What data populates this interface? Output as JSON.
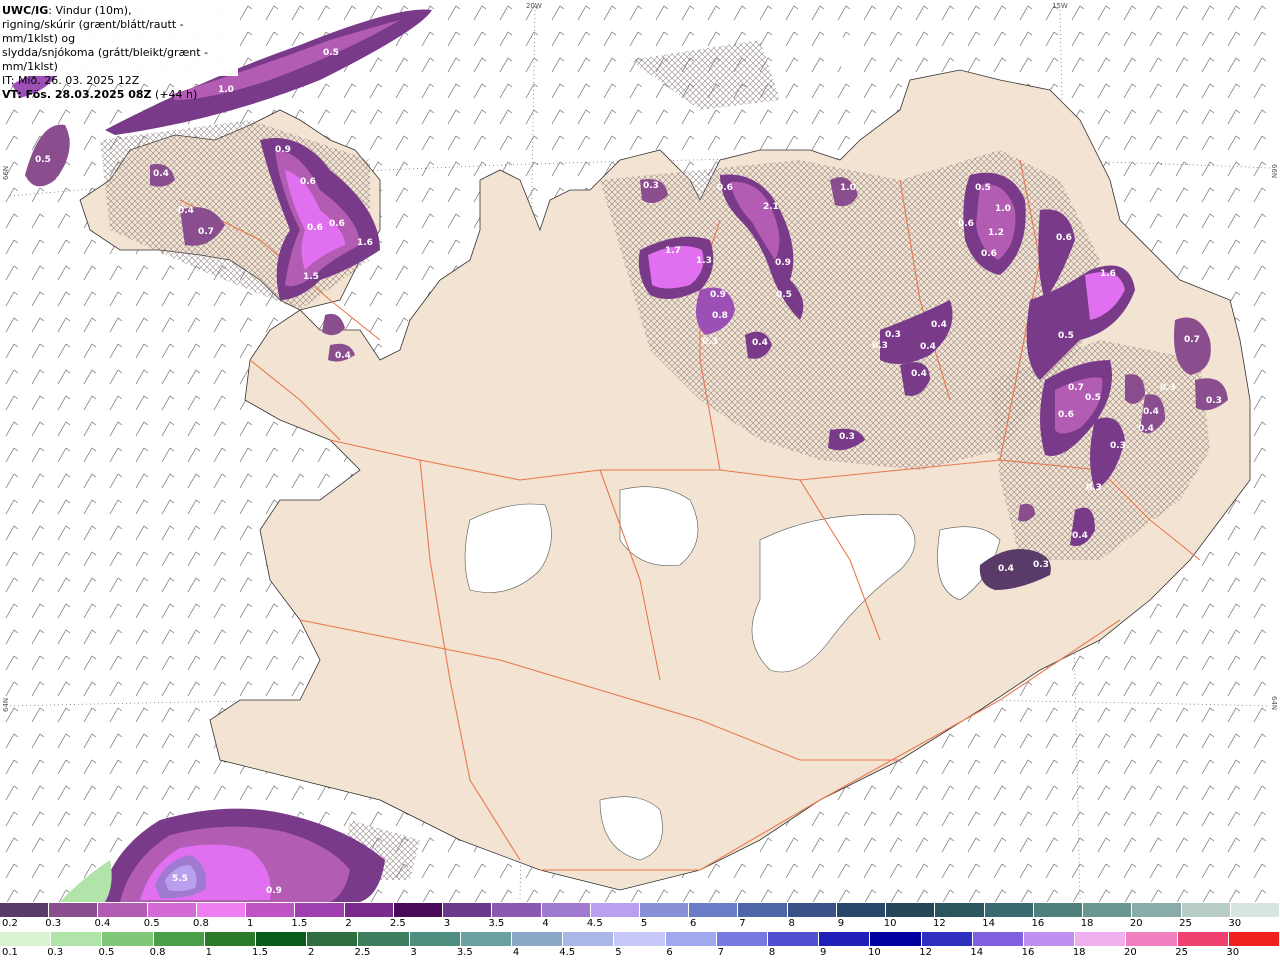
{
  "header": {
    "model": "UWC/IG",
    "line1": ": Vindur (10m),",
    "line2": "rigning/skúrir (grænt/blátt/rautt - mm/1klst) og",
    "line3": "slydda/snjókoma (grátt/bleikt/grænt - mm/1klst)",
    "issue_time": "IT: Mið. 26. 03. 2025 12Z",
    "valid_label": "VT: Fös. 28.03.2025 08Z",
    "lead_time": " (+44 h)"
  },
  "graticule": {
    "top_20w": "20W",
    "top_15w": "15W",
    "left_66n": "66N",
    "right_66n": "66N",
    "left_64n": "64N",
    "right_64n": "64N"
  },
  "colors": {
    "land": "#f2e3d2",
    "sea": "#ffffff",
    "roads": "#e8784e",
    "snow_dark": "#5a3a68",
    "snow_mid": "#9c4fb4",
    "snow_light": "#e070f0"
  },
  "precip_labels": [
    {
      "text": "0.5"
    },
    {
      "text": "1.0"
    },
    {
      "text": "0.3"
    },
    {
      "text": "0.5"
    },
    {
      "text": "0.4"
    },
    {
      "text": "0.9"
    },
    {
      "text": "0.6"
    },
    {
      "text": "0.4"
    },
    {
      "text": "0.7"
    },
    {
      "text": "0.6"
    },
    {
      "text": "0.6"
    },
    {
      "text": "1.6"
    },
    {
      "text": "1.5"
    },
    {
      "text": "0.4"
    },
    {
      "text": "0.3"
    },
    {
      "text": "1.7"
    },
    {
      "text": "1.3"
    },
    {
      "text": "0.9"
    },
    {
      "text": "0.8"
    },
    {
      "text": "0.6"
    },
    {
      "text": "2.1"
    },
    {
      "text": "0.9"
    },
    {
      "text": "0.5"
    },
    {
      "text": "1.0"
    },
    {
      "text": "0.5"
    },
    {
      "text": "1.0"
    },
    {
      "text": "0.6"
    },
    {
      "text": "1.2"
    },
    {
      "text": "0.6"
    },
    {
      "text": "0.6"
    },
    {
      "text": "1.6"
    },
    {
      "text": "0.5"
    },
    {
      "text": "0.7"
    },
    {
      "text": "0.4"
    },
    {
      "text": "0.3"
    },
    {
      "text": "0.3"
    },
    {
      "text": "0.4"
    },
    {
      "text": "0.4"
    },
    {
      "text": "0.3"
    },
    {
      "text": "0.7"
    },
    {
      "text": "0.5"
    },
    {
      "text": "0.6"
    },
    {
      "text": "0.3"
    },
    {
      "text": "0.4"
    },
    {
      "text": "0.3"
    },
    {
      "text": "0.4"
    },
    {
      "text": "0.3"
    },
    {
      "text": "0.4"
    },
    {
      "text": "0.3"
    },
    {
      "text": "0.3"
    },
    {
      "text": "0.4"
    },
    {
      "text": "0.4"
    },
    {
      "text": "0.3"
    },
    {
      "text": "5.5"
    },
    {
      "text": "0.9"
    }
  ],
  "legend": {
    "snow_colors": [
      "#5a3a68",
      "#8a4e8e",
      "#b25cb4",
      "#d46ad6",
      "#f07ef2",
      "#c054c4",
      "#a040b0",
      "#7a2a8a",
      "#4a0a5a",
      "#6a3a8a",
      "#8a5ab0",
      "#a07ad0",
      "#b8a0ee",
      "#8890d8",
      "#6a7cc8",
      "#4e66a8",
      "#3a5288",
      "#2a4668",
      "#244858",
      "#2a5660",
      "#3a6a70",
      "#50807e",
      "#6a9690",
      "#8aaca8",
      "#b8ccc8",
      "#d8e4e0"
    ],
    "snow_ticks": [
      "0.2",
      "0.3",
      "0.4",
      "0.5",
      "0.8",
      "1",
      "1.5",
      "2",
      "2.5",
      "3",
      "3.5",
      "4",
      "4.5",
      "5",
      "6",
      "7",
      "8",
      "9",
      "10",
      "12",
      "14",
      "16",
      "18",
      "20",
      "25",
      "30"
    ],
    "rain_colors": [
      "#d8f4d0",
      "#b0e4a8",
      "#80c878",
      "#4a9e48",
      "#2a7a2a",
      "#0a5a1a",
      "#2e6e3e",
      "#3e7e5e",
      "#4e8e7e",
      "#6aa0a0",
      "#8aa8c8",
      "#aab8e8",
      "#c8c8f8",
      "#a0a8f0",
      "#7878e0",
      "#5050d0",
      "#2020b8",
      "#0000a0",
      "#3030c0",
      "#8060e0",
      "#c090f0",
      "#f0b0f0",
      "#f080c0",
      "#f04070",
      "#f02020"
    ],
    "rain_ticks": [
      "0.1",
      "0.3",
      "0.5",
      "0.8",
      "1",
      "1.5",
      "2",
      "2.5",
      "3",
      "3.5",
      "4",
      "4.5",
      "5",
      "6",
      "7",
      "8",
      "9",
      "10",
      "12",
      "14",
      "16",
      "18",
      "20",
      "25",
      "30"
    ]
  }
}
